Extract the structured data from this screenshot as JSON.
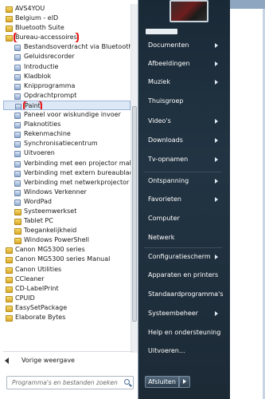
{
  "programs": [
    {
      "label": "AVS4YOU",
      "kind": "folder"
    },
    {
      "label": "Belgium - eID",
      "kind": "folder"
    },
    {
      "label": "Bluetooth Suite",
      "kind": "folder"
    },
    {
      "label": "Bureau-accessoires",
      "kind": "folder",
      "highlight": true
    },
    {
      "label": "Bestandsoverdracht via Bluetooth",
      "kind": "app"
    },
    {
      "label": "Geluidsrecorder",
      "kind": "app"
    },
    {
      "label": "Introductie",
      "kind": "app"
    },
    {
      "label": "Kladblok",
      "kind": "app"
    },
    {
      "label": "Knipprogramma",
      "kind": "app"
    },
    {
      "label": "Opdrachtprompt",
      "kind": "app"
    },
    {
      "label": "Paint",
      "kind": "app",
      "highlight": true,
      "selected": true
    },
    {
      "label": "Paneel voor wiskundige invoer",
      "kind": "app"
    },
    {
      "label": "Plaknotities",
      "kind": "app"
    },
    {
      "label": "Rekenmachine",
      "kind": "app"
    },
    {
      "label": "Synchronisatiecentrum",
      "kind": "app"
    },
    {
      "label": "Uitvoeren",
      "kind": "app"
    },
    {
      "label": "Verbinding met een projector maker",
      "kind": "app"
    },
    {
      "label": "Verbinding met extern bureaublad",
      "kind": "app"
    },
    {
      "label": "Verbinding met netwerkprojector m",
      "kind": "app"
    },
    {
      "label": "Windows Verkenner",
      "kind": "app"
    },
    {
      "label": "WordPad",
      "kind": "app"
    },
    {
      "label": "Systeemwerkset",
      "kind": "folder",
      "indent": true
    },
    {
      "label": "Tablet PC",
      "kind": "folder",
      "indent": true
    },
    {
      "label": "Toegankelijkheid",
      "kind": "folder",
      "indent": true
    },
    {
      "label": "Windows PowerShell",
      "kind": "folder",
      "indent": true
    },
    {
      "label": "Canon MG5300 series",
      "kind": "folder"
    },
    {
      "label": "Canon MG5300 series Manual",
      "kind": "folder"
    },
    {
      "label": "Canon Utilities",
      "kind": "folder"
    },
    {
      "label": "CCleaner",
      "kind": "folder"
    },
    {
      "label": "CD-LabelPrint",
      "kind": "folder"
    },
    {
      "label": "CPUID",
      "kind": "folder"
    },
    {
      "label": "EasySetPackage",
      "kind": "folder"
    },
    {
      "label": "Elaborate Bytes",
      "kind": "folder"
    }
  ],
  "back_label": "Vorige weergave",
  "search_placeholder": "Programma's en bestanden zoeken",
  "right_menu": [
    {
      "label": "Documenten",
      "arrow": true
    },
    {
      "label": "Afbeeldingen",
      "arrow": true
    },
    {
      "label": "Muziek",
      "arrow": true
    },
    {
      "label": "Thuisgroep",
      "arrow": false
    },
    {
      "label": "Video's",
      "arrow": true
    },
    {
      "label": "Downloads",
      "arrow": true
    },
    {
      "label": "Tv-opnamen",
      "arrow": true
    },
    {
      "label": "Ontspanning",
      "arrow": true
    },
    {
      "label": "Favorieten",
      "arrow": true
    },
    {
      "label": "Computer",
      "arrow": false
    },
    {
      "label": "Netwerk",
      "arrow": false
    },
    {
      "label": "Configuratiescherm",
      "arrow": true
    },
    {
      "label": "Apparaten en printers",
      "arrow": false
    },
    {
      "label": "Standaardprogramma's",
      "arrow": false
    },
    {
      "label": "Systeembeheer",
      "arrow": true
    },
    {
      "label": "Help en ondersteuning",
      "arrow": false
    },
    {
      "label": "Uitvoeren...",
      "arrow": false
    }
  ],
  "shutdown_label": "Afsluiten",
  "colors": {
    "highlight_outline": "#ee1111",
    "right_panel": "#1f2f3d"
  }
}
